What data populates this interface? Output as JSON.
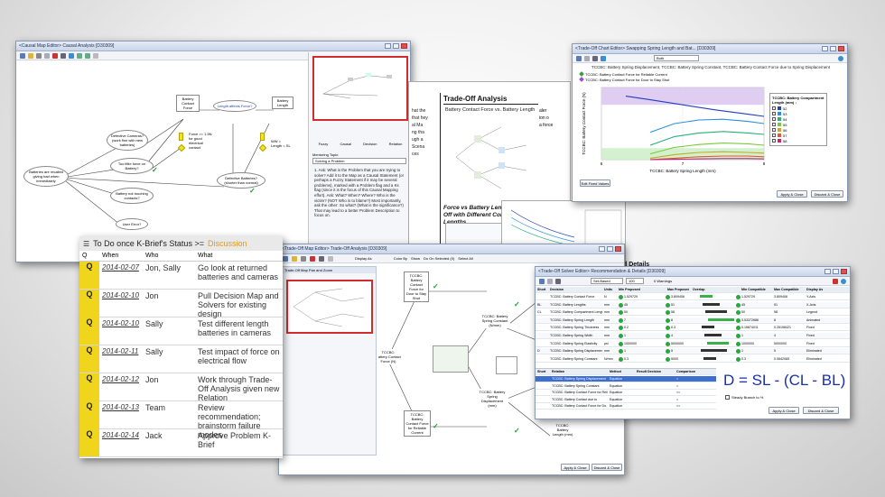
{
  "causal_map": {
    "title": "<Causal Map Editor> Causal Analysis [D30309]",
    "nodes": {
      "battery_contact_force": "Battery Contact Force",
      "length_affects_force": "Length affects Force?",
      "battery_length": "Battery Length",
      "defective_cameras": "Defective Cameras? (work fine with new batteries)",
      "force_gt": "Force >= 1.5N for good electrical contact",
      "ww_length": "WW = Length = SL",
      "too_little_force": "Too little force on Battery?",
      "batteries_recalled": "Batteries are recalled giving bad when immediately",
      "defective_batteries": "Defective Batteries? (shorter than normal)",
      "battery_not_touching": "Battery not touching contacts?",
      "user_error": "User Error?"
    },
    "side_panel": {
      "tabs": [
        "Fuzzy",
        "Causal",
        "Decision",
        "Relation"
      ],
      "mentoring_label": "Mentoring Topic:",
      "mentoring_select": "Solving a Problem",
      "q1": "1. Ask: What is the Problem that you are trying to solve? Add it to the Map as a Causal Statement (or perhaps a Fuzzy Statement if it may be several problems), marked with a Problem flag and a Ks flag (since it is the focus of this Causal Mapping effort). Ask: What? When? Where? Who is the victim? (NOT Who is to blame?) Most importantly, ask the other: So what? (What is the significance?) That may lead to a better Problem Description to focus on.",
      "q2": "2. Ask: Why? What are the likely causes? Ask: What conditions had to also exist for that to happen? Add each"
    }
  },
  "analysis_doc": {
    "heading": "Trade-Off Analysis",
    "subtitle": "Battery Contact Force vs. Battery Length",
    "caption": "Force vs Battery Length Trade-Off with Different Compartment Lengths",
    "left_fragments": [
      "hat the",
      "that hey",
      "al Ma",
      "ng tha",
      "ugh a",
      "Scena",
      "ces"
    ],
    "right_fragments": [
      "aler",
      "ion o",
      "a force"
    ],
    "details_fragment": "d Details"
  },
  "chart_window": {
    "title": "<Trade-Off Chart Editor> Swapping Spring Length and Bat... [D30309]",
    "axis_select": "Both",
    "chart_title": "TCCBC: Battery Spring Displacement, TCCBC: Battery Spring Constant, TCCBC: Battery Contact Force due to Spring Displacement",
    "legend_items": [
      "TCCBC: Battery Contact Force for Reliable Current",
      "TCCBC: Battery Contact Force for Door to Stay Shut"
    ],
    "legend_colors": [
      "#3a9c3a",
      "#9a4fc6"
    ],
    "button_edit": "Edit Fixed Values",
    "button_apply": "Apply & Close",
    "button_discard": "Discard & Close"
  },
  "chart_data": {
    "type": "line",
    "title": "",
    "xlabel": "TCCBC: Battery Spring Length (mm)",
    "ylabel": "TCCBC: Battery Contact Force (N)",
    "xlim": [
      6,
      8
    ],
    "ylim": [
      0,
      10
    ],
    "x_ticks": [
      "6",
      "7",
      "8"
    ],
    "legend_title": "TCCBC: Battery Compartment Length (mm) ↓",
    "series": [
      {
        "name": "52",
        "color": "#1f3fbf",
        "x": [
          6.3,
          6.6,
          7.0,
          7.4,
          7.8,
          8.0
        ],
        "y": [
          8.8,
          8.3,
          7.6,
          6.9,
          6.3,
          6.0
        ]
      },
      {
        "name": "53",
        "color": "#2d8fe0",
        "x": [
          6.6,
          6.9,
          7.2,
          7.5,
          7.8,
          8.0
        ],
        "y": [
          3.8,
          5.0,
          5.5,
          5.6,
          5.3,
          5.0
        ]
      },
      {
        "name": "54",
        "color": "#25b07a",
        "x": [
          6.6,
          6.9,
          7.2,
          7.5,
          7.8,
          8.0
        ],
        "y": [
          2.0,
          3.2,
          3.7,
          3.9,
          3.7,
          3.5
        ]
      },
      {
        "name": "55",
        "color": "#7cc83a",
        "x": [
          6.6,
          6.9,
          7.2,
          7.5,
          7.8,
          8.0
        ],
        "y": [
          0.8,
          1.7,
          2.1,
          2.3,
          2.2,
          2.0
        ]
      },
      {
        "name": "56",
        "color": "#c8a82a",
        "x": [
          6.6,
          6.9,
          7.2,
          7.5,
          7.8,
          8.0
        ],
        "y": [
          0.2,
          0.7,
          1.0,
          1.1,
          1.0,
          0.9
        ]
      },
      {
        "name": "57",
        "color": "#e05a2a",
        "x": [
          6.6,
          6.9,
          7.2,
          7.5,
          7.8,
          8.0
        ],
        "y": [
          0.0,
          0.2,
          0.4,
          0.5,
          0.5,
          0.4
        ]
      },
      {
        "name": "58",
        "color": "#c0238a",
        "x": [
          6.6,
          6.9,
          7.2,
          7.5,
          7.8,
          8.0
        ],
        "y": [
          0.0,
          0.05,
          0.1,
          0.15,
          0.15,
          0.1
        ]
      }
    ],
    "bands": [
      {
        "name": "TCCBC: Battery Contact Force for Door to Stay Shut",
        "color": "#d9c6ee",
        "y": [
          7.6,
          10
        ]
      },
      {
        "name": "TCCBC: Battery Contact Force for Reliable Current",
        "color": "#cdeec7",
        "y": [
          0,
          1.6
        ]
      }
    ]
  },
  "kbrief": {
    "prefix": "To Do once K-Brief's Status >=",
    "status": "Discussion",
    "columns": [
      "Q",
      "When",
      "Who",
      "What"
    ],
    "rows": [
      {
        "q": "Q",
        "when": "2014-02-07",
        "who": "Jon, Sally",
        "what": "Go look at returned batteries and cameras"
      },
      {
        "q": "Q",
        "when": "2014-02-10",
        "who": "Jon",
        "what": "Pull Decision Map and Solvers for existing design"
      },
      {
        "q": "Q",
        "when": "2014-02-10",
        "who": "Sally",
        "what": "Test different length batteries in cameras"
      },
      {
        "q": "Q",
        "when": "2014-02-11",
        "who": "Sally",
        "what": "Test impact of force on electrical flow"
      },
      {
        "q": "Q",
        "when": "2014-02-12",
        "who": "Jon",
        "what": "Work through Trade-Off Analysis given new Relation"
      },
      {
        "q": "Q",
        "when": "2014-02-13",
        "who": "Team",
        "what": "Review recommendation; brainstorm failure modes"
      },
      {
        "q": "Q",
        "when": "2014-02-14",
        "who": "Jack",
        "what": "Approve Problem K-Brief"
      }
    ]
  },
  "tradeoff_map": {
    "title": "<Trade-Off Map Editor> Trade-Off Analysis [D30309]",
    "tab": "Trade-Off Map Pan and Zoom",
    "toolbar": [
      "Display As",
      "Color By",
      "Show",
      "Do On Selected (0)",
      "Select All"
    ],
    "nodes": {
      "door_stay_shut": "TCCBC: Battery Contact Force for Door to Stay Shut",
      "contact_force": "TCCBC: Battery Contact Force (N)",
      "spring_constant": "TCCBC: Battery Spring Constant (N/mm)",
      "spring_displacement": "TCCBC: Battery Spring Displacement (mm)",
      "reliable_current": "TCCBC: Battery Contact Force for Reliable Current",
      "battery_length": "TCCBC: Battery Length (mm)"
    },
    "button_apply": "Apply & Close",
    "button_discard": "Discard & Close"
  },
  "solver": {
    "title": "<Trade-Off Solver Editor> Recommendation & Details [D30309]",
    "set_based_select": "Set-Based",
    "count_select": "100",
    "warnings": "0 Warnings",
    "columns": [
      "Short",
      "Decision",
      "Units",
      "Min Proposed",
      "",
      "Max Proposed",
      "Overlap",
      "Min Compatible",
      "Max Compatible",
      "Display As"
    ],
    "rows": [
      {
        "short": "",
        "decision": "TCCBC: Battery Contact Force",
        "units": "N",
        "min": "1.529729",
        "max": "3.809406",
        "min_c": "1.529729",
        "max_c": "3.809406",
        "display": "Y-Axis"
      },
      {
        "short": "BL",
        "decision": "TCCBC: Battery Lengths",
        "units": "mm",
        "min": "45",
        "max": "51",
        "min_c": "45",
        "max_c": "51",
        "display": "X-Axis"
      },
      {
        "short": "CL",
        "decision": "TCCBC: Battery Compartment Length",
        "units": "mm",
        "min": "50",
        "max": "58",
        "min_c": "50",
        "max_c": "58",
        "display": "Legend"
      },
      {
        "short": "",
        "decision": "TCCBC: Battery Spring Length",
        "units": "mm",
        "min": "7",
        "max": "8",
        "min_c": "3.53372686",
        "max_c": "8",
        "display": "Animated"
      },
      {
        "short": "",
        "decision": "TCCBC: Battery Spring Thickness",
        "units": "mm",
        "min": "0.2",
        "max": "0.3",
        "min_c": "0.15874011",
        "max_c": "0.25198421",
        "display": "Fixed"
      },
      {
        "short": "",
        "decision": "TCCBC: Battery Spring Width",
        "units": "mm",
        "min": "1",
        "max": "4",
        "min_c": "1",
        "max_c": "4",
        "display": "Fixed"
      },
      {
        "short": "",
        "decision": "TCCBC: Battery Spring Elasticity",
        "units": "psi",
        "min": "1000000",
        "max": "5000000",
        "min_c": "1000000",
        "max_c": "5000000",
        "display": "Fixed"
      },
      {
        "short": "D",
        "decision": "TCCBC: Battery Spring Displacement",
        "units": "mm",
        "min": "1",
        "max": "5",
        "min_c": "1",
        "max_c": "5",
        "display": "Eliminated"
      },
      {
        "short": "",
        "decision": "TCCBC: Battery Spring Constant",
        "units": "N/mm",
        "min": "0.3",
        "max": "5000",
        "min_c": "0.3",
        "max_c": "0.0642065",
        "display": "Eliminated"
      }
    ],
    "relation_columns": [
      "Short",
      "Relation",
      "Method",
      "Result Decision",
      "Comparison"
    ],
    "relation_rows": [
      {
        "relation": "TCCBC: Battery Spring Displacement",
        "method": "Equation",
        "comparison": "="
      },
      {
        "relation": "TCCBC: Battery Spring Constant",
        "method": "Equation",
        "comparison": "="
      },
      {
        "relation": "TCCBC: Battery Contact Force for Reli.",
        "method": "Equation",
        "comparison": ">="
      },
      {
        "relation": "TCCBC: Battery Contact due to",
        "method": "Equation",
        "comparison": "="
      },
      {
        "relation": "TCCBC: Battery Contact Force for Do.",
        "method": "Equation",
        "comparison": "<="
      }
    ],
    "equation": "D = SL - (CL - BL)",
    "checkbox_label": "Steady Branch to %",
    "button_apply": "Apply & Close",
    "button_discard": "Discard & Close"
  }
}
